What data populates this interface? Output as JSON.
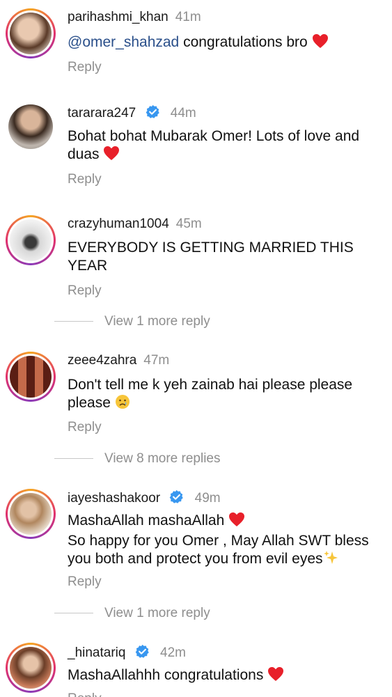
{
  "comments": [
    {
      "username": "parihashmi_khan",
      "verified": false,
      "time": "41m",
      "mention": "@omer_shahzad",
      "text": " congratulations bro",
      "emoji": "heart-icon",
      "reply_label": "Reply"
    },
    {
      "username": "tararara247",
      "verified": true,
      "time": "44m",
      "text_line1": "Bohat bohat Mubarak Omer! Lots of love and",
      "text_line2": "duas",
      "emoji": "heart-icon",
      "reply_label": "Reply"
    },
    {
      "username": "crazyhuman1004",
      "verified": false,
      "time": "45m",
      "text_line1": "EVERYBODY IS GETTING MARRIED THIS",
      "text_line2": "YEAR",
      "reply_label": "Reply",
      "more_replies": "View 1 more reply"
    },
    {
      "username": "zeee4zahra",
      "verified": false,
      "time": "47m",
      "text_line1": "Don't tell me k yeh zainab hai please please",
      "text_line2": "please",
      "emoji": "crying-face-icon",
      "reply_label": "Reply",
      "more_replies": "View 8 more replies"
    },
    {
      "username": "iayeshashakoor",
      "verified": true,
      "time": "49m",
      "text_line1": "MashaAllah mashaAllah",
      "text_line2": "So happy for you Omer , May Allah SWT bless",
      "text_line3": "you both and protect you from evil eyes",
      "emoji": "heart-icon",
      "emoji2": "sparkles-icon",
      "reply_label": "Reply",
      "more_replies": "View 1 more reply"
    },
    {
      "username": "_hinatariq",
      "verified": true,
      "time": "42m",
      "text": "MashaAllahhh congratulations",
      "emoji": "heart-icon",
      "reply_label": "Reply"
    }
  ],
  "colors": {
    "username": "#1a1a1a",
    "meta_gray": "#8e8e8e",
    "mention": "#2a4f8a",
    "verified_blue": "#3897f0",
    "heart_red": "#e8202a"
  }
}
